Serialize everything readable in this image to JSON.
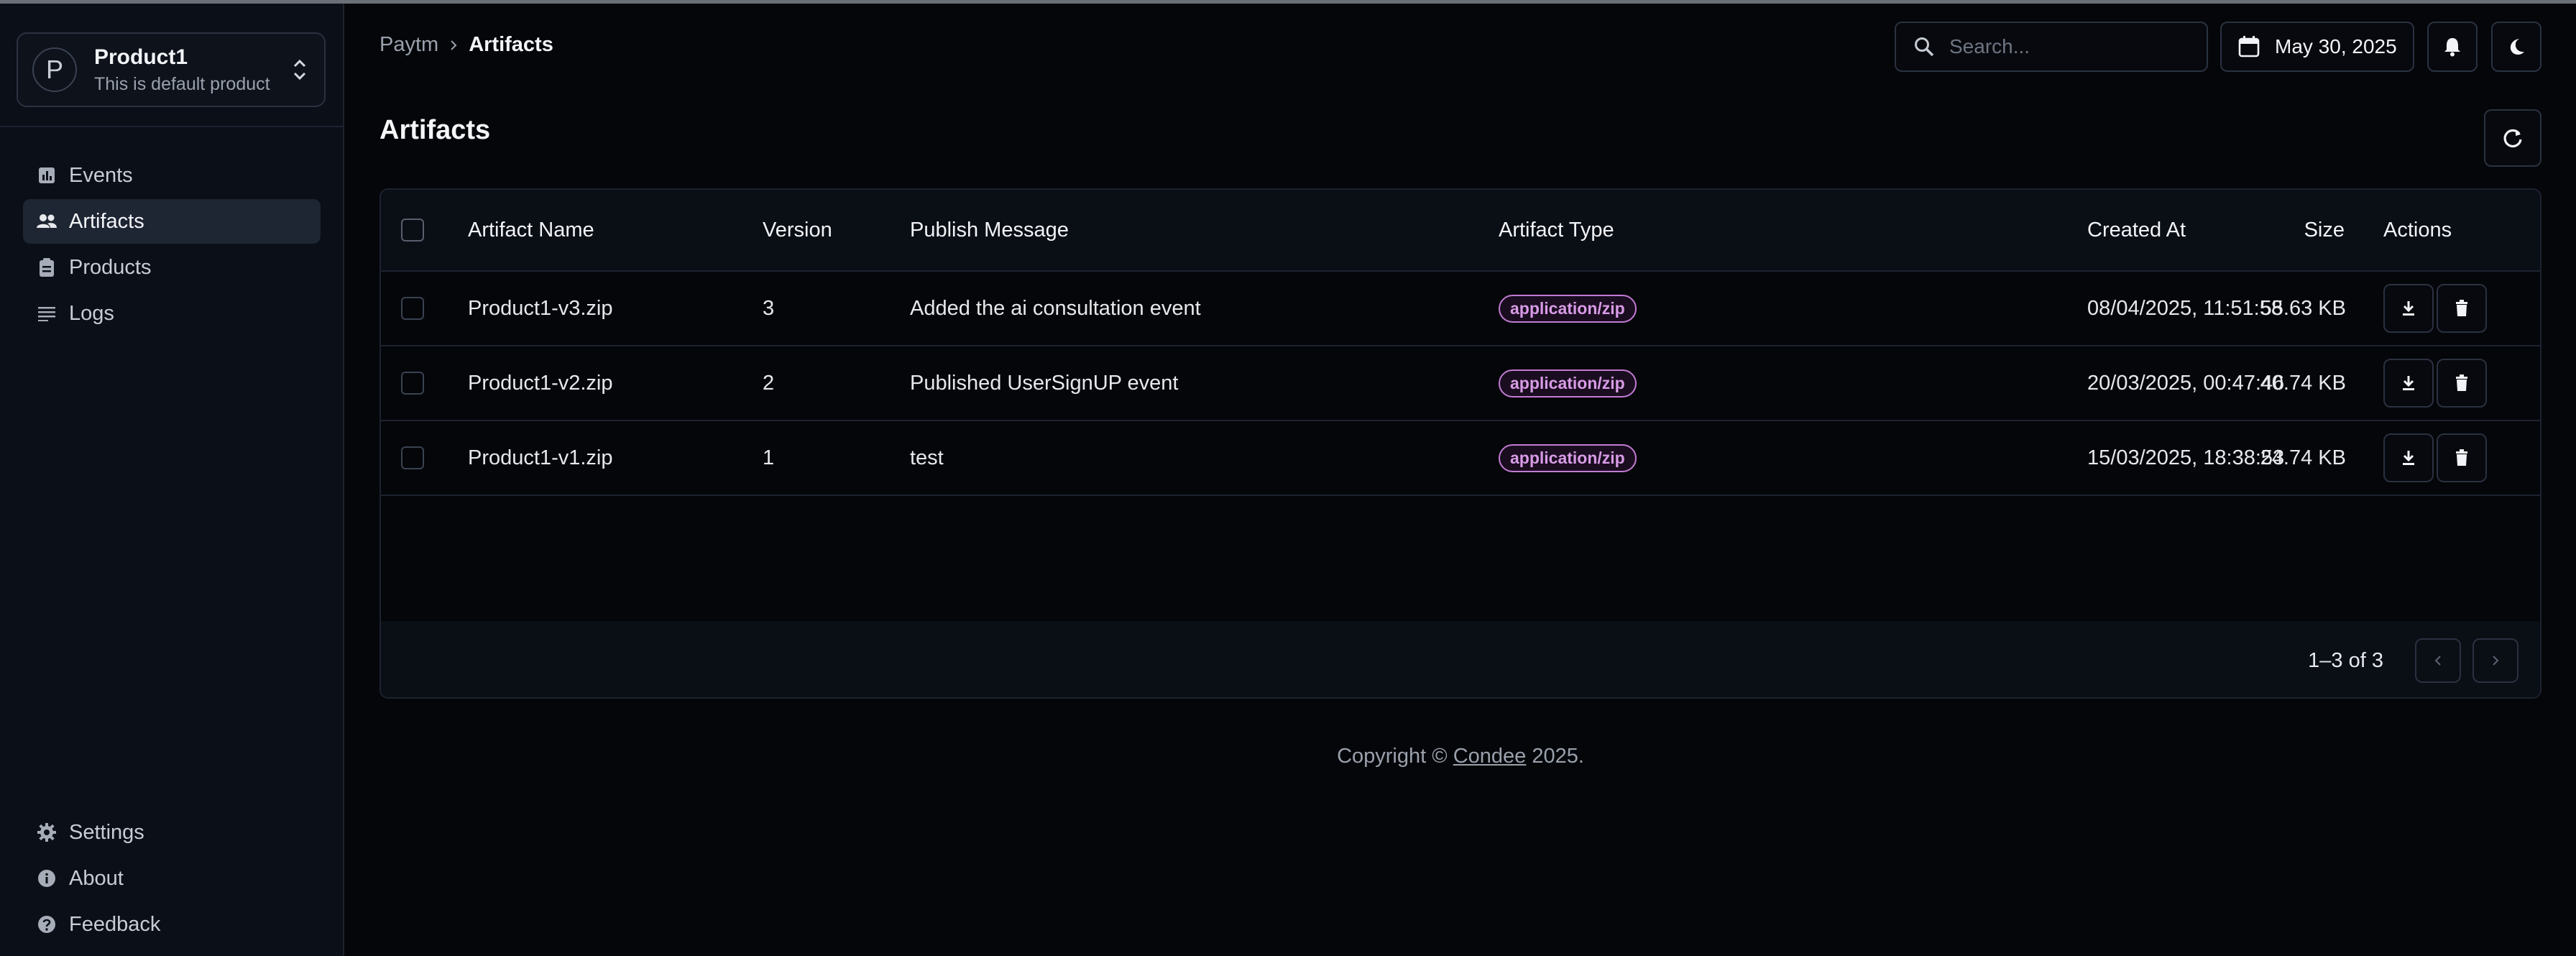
{
  "product": {
    "initial": "P",
    "name": "Product1",
    "description": "This is default product"
  },
  "sidebar": {
    "items": [
      {
        "label": "Events",
        "icon": "chart-icon",
        "active": false
      },
      {
        "label": "Artifacts",
        "icon": "people-icon",
        "active": true
      },
      {
        "label": "Products",
        "icon": "clipboard-icon",
        "active": false
      },
      {
        "label": "Logs",
        "icon": "list-icon",
        "active": false
      }
    ],
    "bottom_items": [
      {
        "label": "Settings",
        "icon": "gear-icon"
      },
      {
        "label": "About",
        "icon": "info-icon"
      },
      {
        "label": "Feedback",
        "icon": "help-icon"
      }
    ]
  },
  "breadcrumb": {
    "root": "Paytm",
    "current": "Artifacts"
  },
  "header": {
    "search_placeholder": "Search...",
    "date": "May 30, 2025"
  },
  "page": {
    "title": "Artifacts"
  },
  "table": {
    "columns": [
      "Artifact Name",
      "Version",
      "Publish Message",
      "Artifact Type",
      "Size",
      "Created At",
      "Actions"
    ],
    "rows": [
      {
        "name": "Product1-v3.zip",
        "version": "3",
        "message": "Added the ai consultation event",
        "type": "application/zip",
        "size": "55.63 KB",
        "created": "08/04/2025, 11:51:58"
      },
      {
        "name": "Product1-v2.zip",
        "version": "2",
        "message": "Published UserSignUP event",
        "type": "application/zip",
        "size": "40.74 KB",
        "created": "20/03/2025, 00:47:46"
      },
      {
        "name": "Product1-v1.zip",
        "version": "1",
        "message": "test",
        "type": "application/zip",
        "size": "24.74 KB",
        "created": "15/03/2025, 18:38:53"
      }
    ]
  },
  "pagination": {
    "info": "1–3 of 3"
  },
  "footer": {
    "prefix": "Copyright © ",
    "link": "Condee",
    "suffix": " 2025."
  },
  "colors": {
    "accent_badge": "#c27bd4",
    "background": "#050609",
    "sidebar": "#0b0f17"
  }
}
